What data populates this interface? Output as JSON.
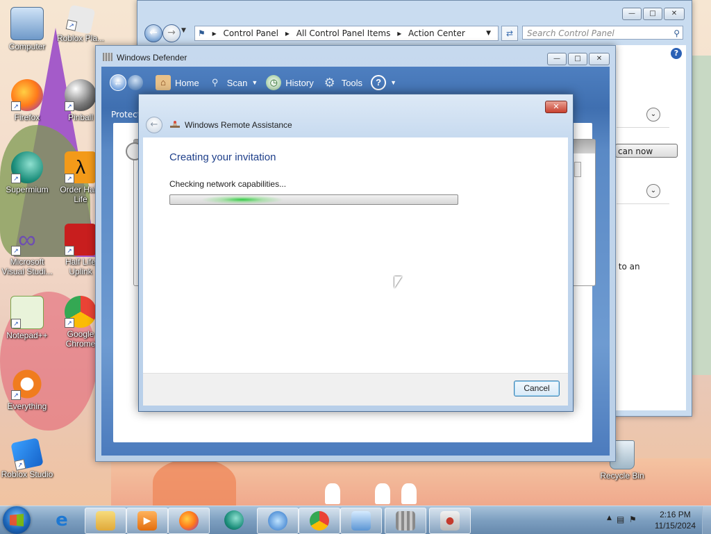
{
  "desktop": {
    "icons": [
      {
        "label": "Computer"
      },
      {
        "label": "Roblox Pla..."
      },
      {
        "label": "Firefox"
      },
      {
        "label": "Pinball"
      },
      {
        "label": "Supermium"
      },
      {
        "label": "Order Half-Life"
      },
      {
        "label": "Microsoft Visual Studi..."
      },
      {
        "label": "Half Life Uplink"
      },
      {
        "label": "Notepad++"
      },
      {
        "label": "Google Chrome"
      },
      {
        "label": "Everything"
      },
      {
        "label": "Roblox Studio"
      },
      {
        "label": "Recycle Bin"
      }
    ]
  },
  "control_panel": {
    "breadcrumb": [
      "Control Panel",
      "All Control Panel Items",
      "Action Center"
    ],
    "search_placeholder": "Search Control Panel",
    "button_fragment": "can now",
    "text_fragment": "r to an"
  },
  "defender": {
    "title": "Windows Defender",
    "toolbar": {
      "home": "Home",
      "scan": "Scan",
      "history": "History",
      "tools": "Tools"
    },
    "status_fragment": "Protect"
  },
  "remote_assistance": {
    "title": "Windows Remote Assistance",
    "heading": "Creating your invitation",
    "status": "Checking network capabilities...",
    "progress": 0.25,
    "cancel_label": "Cancel"
  },
  "taskbar": {
    "time": "2:16 PM",
    "date": "11/15/2024"
  }
}
